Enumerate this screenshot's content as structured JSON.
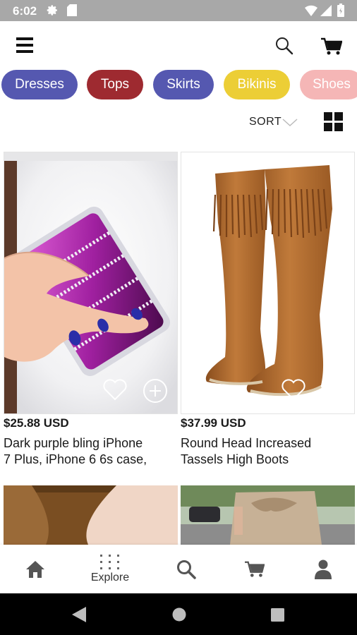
{
  "status_bar": {
    "time": "6:02",
    "icons": [
      "gear-icon",
      "sd-card-icon",
      "wifi-icon",
      "signal-icon",
      "battery-icon"
    ]
  },
  "header": {
    "icons": [
      "menu-icon",
      "search-icon",
      "cart-icon"
    ]
  },
  "categories": [
    {
      "label": "Dresses",
      "color": "#5558b0"
    },
    {
      "label": "Tops",
      "color": "#9e2a30"
    },
    {
      "label": "Skirts",
      "color": "#5558b0"
    },
    {
      "label": "Bikinis",
      "color": "#ecce36"
    },
    {
      "label": "Shoes",
      "color": "#f5b6b6"
    }
  ],
  "toolbar": {
    "sort_label": "SORT",
    "icons": [
      "chevron-down-icon",
      "grid-view-icon"
    ]
  },
  "products": [
    {
      "price": "$25.88 USD",
      "title_line1": "Dark purple bling iPhone",
      "title_line2": "7 Plus, iPhone 6 6s case,",
      "icons": [
        "heart-icon",
        "add-icon"
      ]
    },
    {
      "price": "$37.99 USD",
      "title_line1": "Round Head Increased",
      "title_line2": "Tassels High Boots",
      "icons": [
        "heart-icon"
      ]
    }
  ],
  "bottom_nav": {
    "items": [
      {
        "label": "",
        "icon": "home-icon"
      },
      {
        "label": "Explore",
        "icon": "explore-dots-icon"
      },
      {
        "label": "",
        "icon": "search-icon"
      },
      {
        "label": "",
        "icon": "cart-icon"
      },
      {
        "label": "",
        "icon": "profile-icon"
      }
    ]
  },
  "system_nav": {
    "icons": [
      "back-icon",
      "home-circle-icon",
      "recents-icon"
    ]
  }
}
